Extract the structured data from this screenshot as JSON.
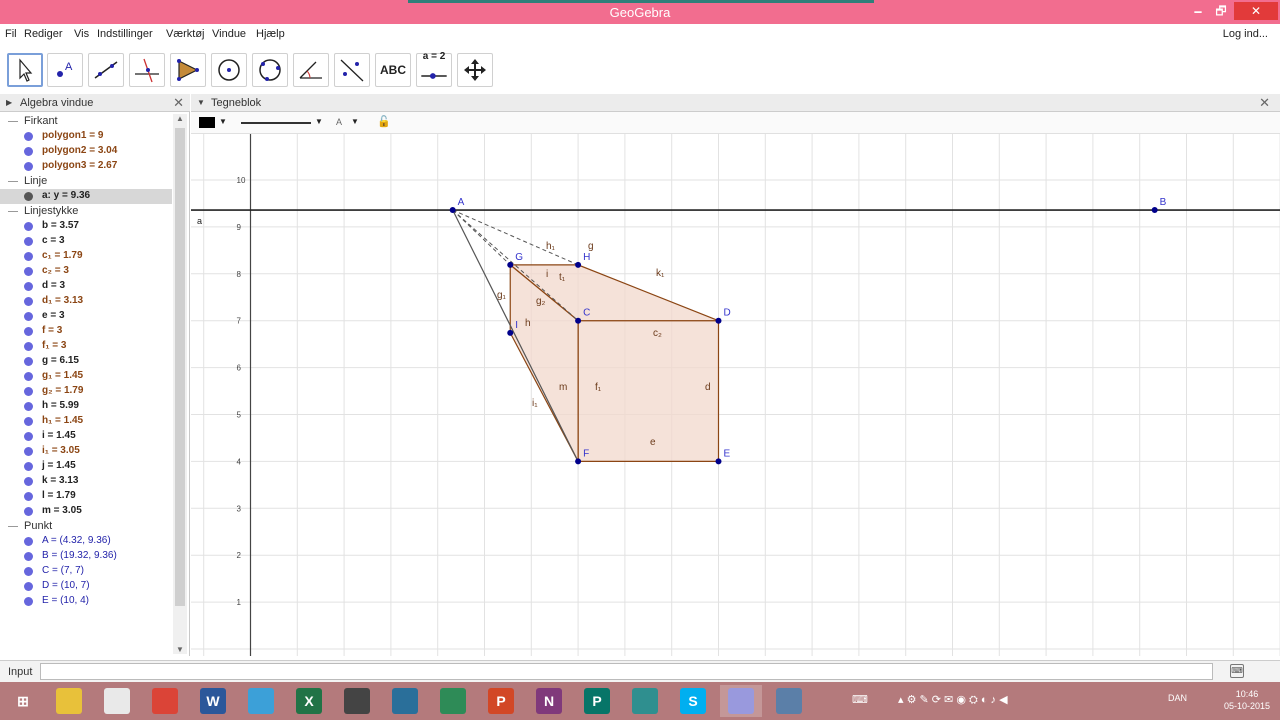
{
  "window": {
    "title": "GeoGebra",
    "minimize": "🗕",
    "maximize": "🗗",
    "close": "✕"
  },
  "menu": {
    "items": [
      "Fil",
      "Rediger",
      "Vis",
      "Indstillinger",
      "Værktøj",
      "Vindue",
      "Hjælp"
    ],
    "login": "Log ind..."
  },
  "toolbar": {
    "tools": [
      {
        "name": "move-tool-button",
        "icon": "arrow-cursor-icon"
      },
      {
        "name": "point-tool-button",
        "icon": "point-a-icon"
      },
      {
        "name": "line-tool-button",
        "icon": "line-icon"
      },
      {
        "name": "perpendicular-line-tool-button",
        "icon": "perpendicular-icon"
      },
      {
        "name": "polygon-tool-button",
        "icon": "polygon-icon"
      },
      {
        "name": "circle-tool-button",
        "icon": "circle-center-icon"
      },
      {
        "name": "circle-three-points-tool-button",
        "icon": "circle-points-icon"
      },
      {
        "name": "angle-tool-button",
        "icon": "angle-icon"
      },
      {
        "name": "reflect-tool-button",
        "icon": "reflect-line-icon"
      },
      {
        "name": "text-tool-button",
        "icon": "text-abc-icon",
        "label": "ABC"
      },
      {
        "name": "slider-tool-button",
        "icon": "slider-icon",
        "label": "a = 2"
      },
      {
        "name": "move-graphics-tool-button",
        "icon": "move-view-icon"
      }
    ],
    "undo": "↶",
    "redo": "↷",
    "help": "?",
    "settings": "⚙"
  },
  "algebra": {
    "title": "Algebra vindue",
    "close": "✕",
    "rows": [
      {
        "type": "cat",
        "text": "Firkant"
      },
      {
        "type": "item",
        "text": "polygon1 = 9",
        "color": "brown"
      },
      {
        "type": "item",
        "text": "polygon2 = 3.04",
        "color": "brown"
      },
      {
        "type": "item",
        "text": "polygon3 = 2.67",
        "color": "brown"
      },
      {
        "type": "cat",
        "text": "Linje"
      },
      {
        "type": "item",
        "text": "a: y = 9.36",
        "color": "dark",
        "dot": "black",
        "selected": true
      },
      {
        "type": "cat",
        "text": "Linjestykke"
      },
      {
        "type": "item",
        "text": "b = 3.57",
        "color": "dark"
      },
      {
        "type": "item",
        "text": "c = 3",
        "color": "dark"
      },
      {
        "type": "item",
        "text": "c₁ = 1.79",
        "color": "brown"
      },
      {
        "type": "item",
        "text": "c₂ = 3",
        "color": "brown"
      },
      {
        "type": "item",
        "text": "d = 3",
        "color": "dark"
      },
      {
        "type": "item",
        "text": "d₁ = 3.13",
        "color": "brown"
      },
      {
        "type": "item",
        "text": "e = 3",
        "color": "dark"
      },
      {
        "type": "item",
        "text": "f = 3",
        "color": "brown"
      },
      {
        "type": "item",
        "text": "f₁ = 3",
        "color": "brown"
      },
      {
        "type": "item",
        "text": "g = 6.15",
        "color": "dark"
      },
      {
        "type": "item",
        "text": "g₁ = 1.45",
        "color": "brown"
      },
      {
        "type": "item",
        "text": "g₂ = 1.79",
        "color": "brown"
      },
      {
        "type": "item",
        "text": "h = 5.99",
        "color": "dark"
      },
      {
        "type": "item",
        "text": "h₁ = 1.45",
        "color": "brown"
      },
      {
        "type": "item",
        "text": "i = 1.45",
        "color": "dark"
      },
      {
        "type": "item",
        "text": "i₁ = 3.05",
        "color": "brown"
      },
      {
        "type": "item",
        "text": "j = 1.45",
        "color": "dark"
      },
      {
        "type": "item",
        "text": "k = 3.13",
        "color": "dark"
      },
      {
        "type": "item",
        "text": "l = 1.79",
        "color": "dark"
      },
      {
        "type": "item",
        "text": "m = 3.05",
        "color": "dark"
      },
      {
        "type": "cat",
        "text": "Punkt"
      },
      {
        "type": "item",
        "text": "A = (4.32, 9.36)",
        "color": "blue"
      },
      {
        "type": "item",
        "text": "B = (19.32, 9.36)",
        "color": "blue"
      },
      {
        "type": "item",
        "text": "C = (7, 7)",
        "color": "blue"
      },
      {
        "type": "item",
        "text": "D = (10, 7)",
        "color": "blue"
      },
      {
        "type": "item",
        "text": "E = (10, 4)",
        "color": "blue"
      }
    ]
  },
  "graphics": {
    "title": "Tegneblok",
    "close": "✕",
    "style_bar": {
      "line_style": "——",
      "label_style": "A"
    },
    "y_ticks": [
      "1",
      "2",
      "3",
      "4",
      "5",
      "6",
      "7",
      "8",
      "9",
      "10"
    ],
    "line_label": "a",
    "points": [
      {
        "label": "A",
        "x": 4.32,
        "y": 9.36
      },
      {
        "label": "B",
        "x": 19.32,
        "y": 9.36
      },
      {
        "label": "C",
        "x": 7,
        "y": 7
      },
      {
        "label": "D",
        "x": 10,
        "y": 7
      },
      {
        "label": "E",
        "x": 10,
        "y": 4
      },
      {
        "label": "F",
        "x": 7,
        "y": 4
      },
      {
        "label": "G",
        "x": 5.55,
        "y": 8.19
      },
      {
        "label": "H",
        "x": 7,
        "y": 8.19
      },
      {
        "label": "I",
        "x": 5.55,
        "y": 6.74
      }
    ],
    "segment_labels": [
      "h₁",
      "g",
      "i",
      "t₁",
      "g₁",
      "g₂",
      "h",
      "c₂",
      "m",
      "f₁",
      "d",
      "e",
      "i₁",
      "k₁"
    ],
    "colors": {
      "fill": "#f2d8cc",
      "edge": "#8b4513",
      "point": "#00008b",
      "label": "#3333cc",
      "grid": "#e2e2e2"
    }
  },
  "input": {
    "label": "Input",
    "value": "",
    "keyboard": "⌨"
  },
  "taskbar": {
    "apps": [
      {
        "name": "start-button",
        "icon": "windows-icon",
        "label": "⊞",
        "bg": "#b47a7c"
      },
      {
        "name": "taskbar-file-explorer",
        "icon": "folder-icon",
        "label": "",
        "bg": "#e8c13a"
      },
      {
        "name": "taskbar-paint",
        "icon": "paint-icon",
        "label": "",
        "bg": "#e9e9e9"
      },
      {
        "name": "taskbar-chrome",
        "icon": "chrome-icon",
        "label": "",
        "bg": "#db4437"
      },
      {
        "name": "taskbar-word",
        "icon": "word-icon",
        "label": "W",
        "bg": "#2b579a"
      },
      {
        "name": "taskbar-notes",
        "icon": "notes-icon",
        "label": "",
        "bg": "#3ca0d8"
      },
      {
        "name": "taskbar-excel",
        "icon": "excel-icon",
        "label": "X",
        "bg": "#217346"
      },
      {
        "name": "taskbar-camera",
        "icon": "camera-icon",
        "label": "",
        "bg": "#444444"
      },
      {
        "name": "taskbar-sketch",
        "icon": "sketch-icon",
        "label": "",
        "bg": "#2a6f9a"
      },
      {
        "name": "taskbar-calculator",
        "icon": "calculator-icon",
        "label": "",
        "bg": "#2e8b57"
      },
      {
        "name": "taskbar-powerpoint",
        "icon": "powerpoint-icon",
        "label": "P",
        "bg": "#d24726"
      },
      {
        "name": "taskbar-onenote",
        "icon": "onenote-icon",
        "label": "N",
        "bg": "#80397b"
      },
      {
        "name": "taskbar-publisher",
        "icon": "publisher-icon",
        "label": "P",
        "bg": "#077568"
      },
      {
        "name": "taskbar-search-app",
        "icon": "magnifier-icon",
        "label": "",
        "bg": "#2f8f8f"
      },
      {
        "name": "taskbar-skype",
        "icon": "skype-icon",
        "label": "S",
        "bg": "#00aff0"
      },
      {
        "name": "taskbar-geogebra",
        "icon": "geogebra-icon",
        "label": "",
        "bg": "#9999dd",
        "active": true
      },
      {
        "name": "taskbar-network-app",
        "icon": "network-icon",
        "label": "",
        "bg": "#5b7fa8"
      }
    ],
    "tray_lang": "DAN",
    "time": "10:46",
    "date": "05-10-2015"
  }
}
